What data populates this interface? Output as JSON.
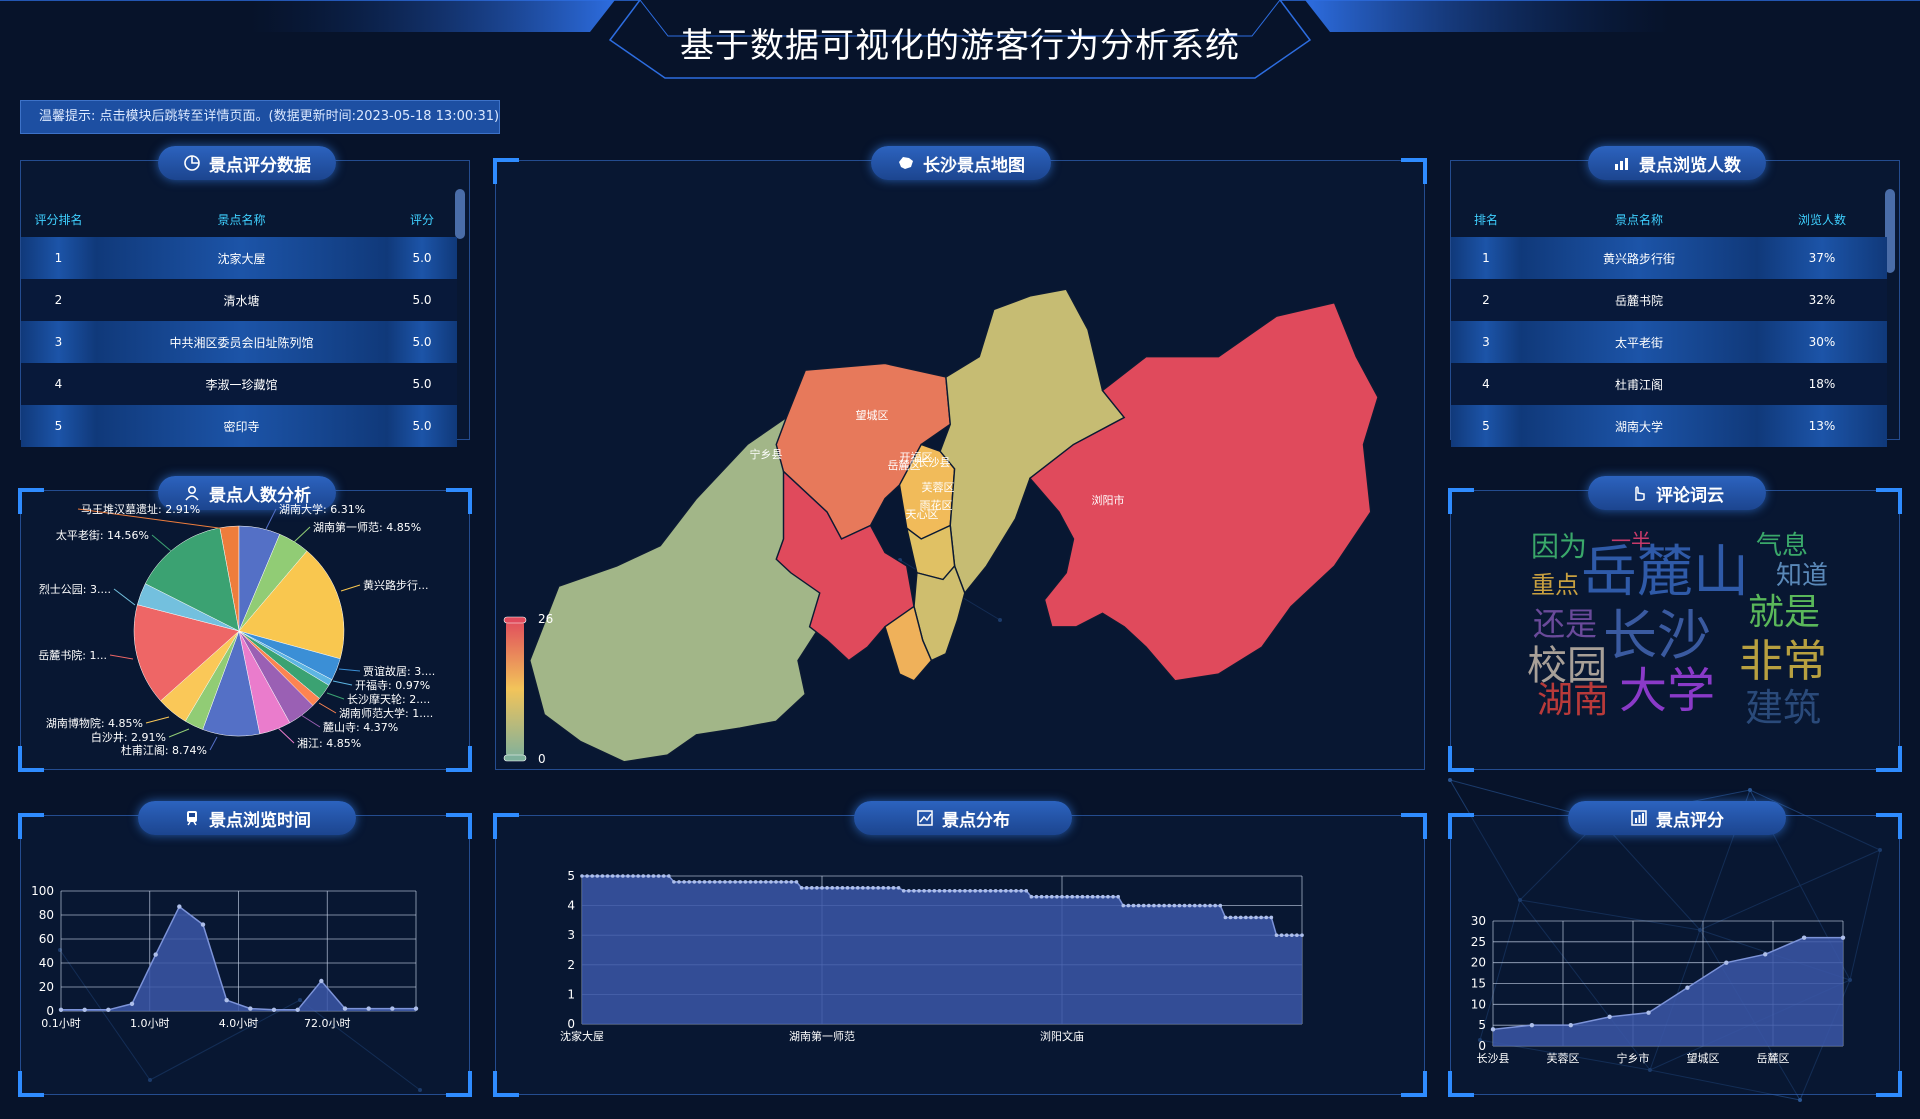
{
  "header": {
    "title": "基于数据可视化的游客行为分析系统"
  },
  "notice": "温馨提示: 点击模块后跳转至详情页面。(数据更新时间:2023-05-18 13:00:31)",
  "rating_table": {
    "title": "景点评分数据",
    "headers": [
      "评分排名",
      "景点名称",
      "评分"
    ],
    "rows": [
      [
        "1",
        "沈家大屋",
        "5.0"
      ],
      [
        "2",
        "清水塘",
        "5.0"
      ],
      [
        "3",
        "中共湘区委员会旧址陈列馆",
        "5.0"
      ],
      [
        "4",
        "李淑一珍藏馆",
        "5.0"
      ],
      [
        "5",
        "密印寺",
        "5.0"
      ]
    ]
  },
  "map": {
    "title": "长沙景点地图",
    "visual_max": "26",
    "visual_min": "0",
    "region_labels": [
      "宁乡县",
      "望城区",
      "开福区",
      "长沙县",
      "岳麓区",
      "芙蓉区",
      "雨花区",
      "天心区",
      "浏阳市"
    ],
    "region_values": [
      4,
      21,
      14,
      8,
      26,
      11,
      9,
      15,
      26
    ],
    "colors": {
      "low": "#7fb09c",
      "mid": "#f2c45a",
      "high": "#e04a5c"
    }
  },
  "views_table": {
    "title": "景点浏览人数",
    "headers": [
      "排名",
      "景点名称",
      "浏览人数"
    ],
    "rows": [
      [
        "1",
        "黄兴路步行街",
        "37%"
      ],
      [
        "2",
        "岳麓书院",
        "32%"
      ],
      [
        "3",
        "太平老街",
        "30%"
      ],
      [
        "4",
        "杜甫江阁",
        "18%"
      ],
      [
        "5",
        "湖南大学",
        "13%"
      ]
    ]
  },
  "pie_title": "景点人数分析",
  "cloud": {
    "title": "评论词云",
    "words": [
      "因为",
      "一半",
      "岳麓山",
      "气息",
      "知道",
      "重点",
      "还是",
      "就是",
      "长沙",
      "校园",
      "非常",
      "湖南",
      "大学",
      "建筑"
    ],
    "colors": [
      "#3aa86a",
      "#c83a6a",
      "#2f5aa8",
      "#3aa86a",
      "#5a88b8",
      "#c8a040",
      "#6a4a9a",
      "#5ab85a",
      "#3a5aa0",
      "#a8a098",
      "#b8a040",
      "#b83a3a",
      "#8a3ac8",
      "#2a4a7a"
    ]
  },
  "time_chart_title": "景点浏览时间",
  "dist_chart_title": "景点分布",
  "score_chart_title": "景点评分",
  "chart_data": [
    {
      "type": "pie",
      "title": "",
      "labels": [
        "马王堆汉墓遗址: 2.91%",
        "湖南大学: 6.31%",
        "湖南第一师范: 4.85%",
        "黄兴路步行...",
        "贾谊故居: 3....",
        "开福寺: 0.97%",
        "长沙摩天轮: 2....",
        "湖南师范大学: 1....",
        "麓山寺: 4.37%",
        "湘江: 4.85%",
        "杜甫江阁: 8.74%",
        "白沙井: 2.91%",
        "湖南博物院: 4.85%",
        "岳麓书院: 1...",
        "烈士公园: 3....",
        "太平老街: 14.56%"
      ],
      "values": [
        2.91,
        6.31,
        4.85,
        17.96,
        3.4,
        0.97,
        2.43,
        1.46,
        4.37,
        4.85,
        8.74,
        2.91,
        4.85,
        15.53,
        3.4,
        14.56
      ],
      "colors": [
        "#ee7d3c",
        "#5470c6",
        "#91cc75",
        "#f9c74f",
        "#3b8fd6",
        "#5db5e2",
        "#3ba272",
        "#fc8452",
        "#9a60b4",
        "#ea7ccc",
        "#5470c6",
        "#91cc75",
        "#fac858",
        "#ee6666",
        "#73c0de",
        "#3ba272"
      ]
    },
    {
      "type": "area",
      "title": "",
      "categories": [
        "0.1小时",
        "1.0小时",
        "4.0小时",
        "72.0小时"
      ],
      "x": [
        0,
        1,
        2,
        3,
        4,
        5,
        6,
        7,
        8,
        9,
        10,
        11,
        12,
        13,
        14,
        15
      ],
      "values": [
        1,
        1,
        1,
        6,
        47,
        87,
        72,
        9,
        2,
        1,
        1,
        25,
        2,
        2,
        2,
        2
      ],
      "ylim": [
        0,
        100
      ],
      "yticks": [
        "0",
        "20",
        "40",
        "60",
        "80",
        "100"
      ]
    },
    {
      "type": "area",
      "title": "",
      "categories": [
        "沈家大屋",
        "湖南第一师范",
        "浏阳文庙"
      ],
      "values": [
        5.0,
        4.8,
        4.6,
        4.5,
        4.3,
        4.0,
        3.6,
        3.0
      ],
      "ylim": [
        0,
        5
      ],
      "yticks": [
        "0",
        "1",
        "2",
        "3",
        "4",
        "5"
      ]
    },
    {
      "type": "area",
      "title": "",
      "categories": [
        "长沙县",
        "芙蓉区",
        "宁乡市",
        "望城区",
        "岳麓区"
      ],
      "x": [
        0,
        1,
        2,
        3,
        4,
        5,
        6,
        7,
        8,
        9
      ],
      "values": [
        4,
        5,
        5,
        7,
        8,
        14,
        20,
        22,
        26,
        26
      ],
      "ylim": [
        0,
        30
      ],
      "yticks": [
        "0",
        "5",
        "10",
        "15",
        "20",
        "25",
        "30"
      ]
    }
  ]
}
